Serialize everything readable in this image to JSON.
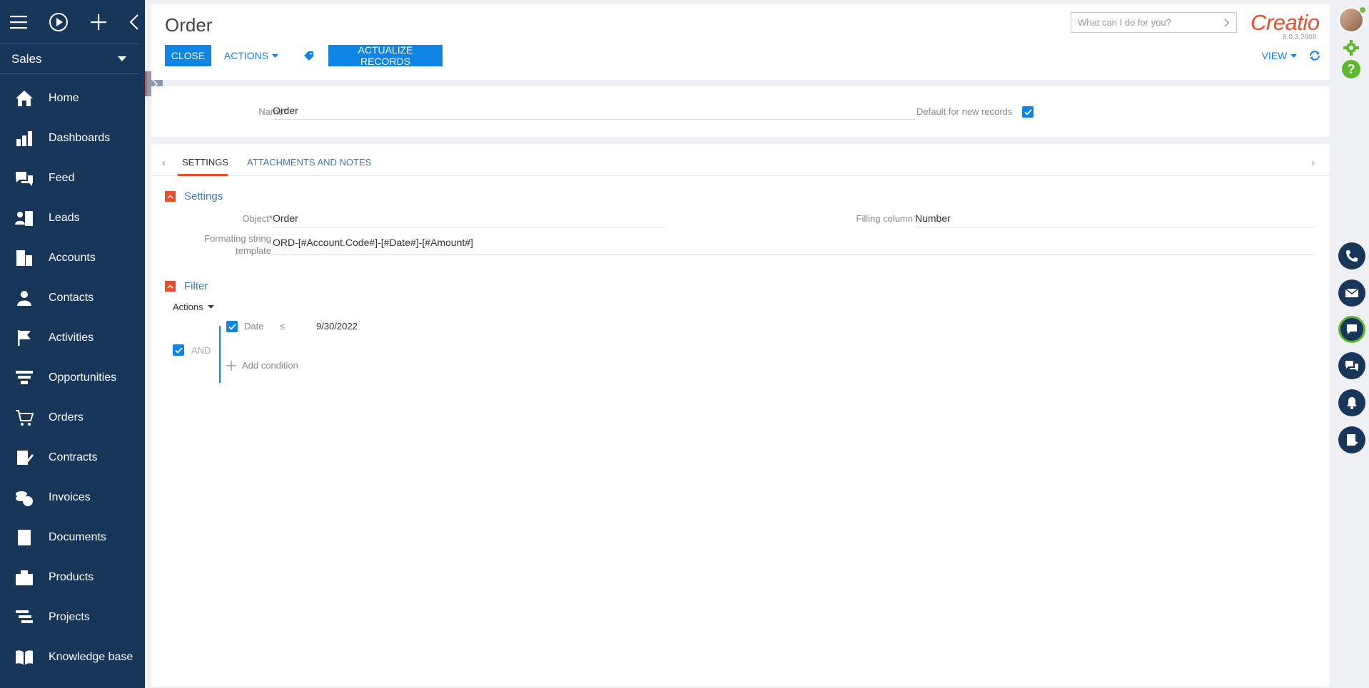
{
  "sidebar": {
    "workplace": "Sales",
    "items": [
      {
        "label": "Home",
        "icon": "home-icon"
      },
      {
        "label": "Dashboards",
        "icon": "dashboards-icon"
      },
      {
        "label": "Feed",
        "icon": "feed-icon"
      },
      {
        "label": "Leads",
        "icon": "leads-icon"
      },
      {
        "label": "Accounts",
        "icon": "accounts-icon"
      },
      {
        "label": "Contacts",
        "icon": "contacts-icon"
      },
      {
        "label": "Activities",
        "icon": "flag-icon"
      },
      {
        "label": "Opportunities",
        "icon": "funnel-icon"
      },
      {
        "label": "Orders",
        "icon": "cart-icon"
      },
      {
        "label": "Contracts",
        "icon": "contract-icon"
      },
      {
        "label": "Invoices",
        "icon": "invoice-icon"
      },
      {
        "label": "Documents",
        "icon": "document-icon"
      },
      {
        "label": "Products",
        "icon": "products-icon"
      },
      {
        "label": "Projects",
        "icon": "projects-icon"
      },
      {
        "label": "Knowledge base",
        "icon": "book-icon"
      }
    ]
  },
  "header": {
    "title": "Order",
    "close_label": "CLOSE",
    "actions_label": "ACTIONS",
    "actualize_label": "ACTUALIZE RECORDS",
    "view_label": "VIEW",
    "search_placeholder": "What can I do for you?",
    "logo": "Creatio",
    "version": "8.0.3.2908"
  },
  "name_panel": {
    "name_label": "Name",
    "name_value": "Order",
    "default_label": "Default for new records",
    "default_checked": true
  },
  "tabs": [
    {
      "label": "SETTINGS",
      "active": true
    },
    {
      "label": "ATTACHMENTS AND NOTES",
      "active": false
    }
  ],
  "settings": {
    "title": "Settings",
    "object_label": "Object",
    "object_value": "Order",
    "filling_column_label": "Filling column",
    "filling_column_value": "Number",
    "template_label_line1": "Formating string",
    "template_label_line2": "template",
    "template_value": "ORD-[#Account.Code#]-[#Date#]-[#Amount#]"
  },
  "filter": {
    "title": "Filter",
    "actions_label": "Actions",
    "group_operator": "AND",
    "condition": {
      "field": "Date",
      "operator": "≤",
      "value": "9/30/2022"
    },
    "add_condition_label": "Add condition"
  },
  "colors": {
    "sidebar_bg": "#17365a",
    "accent_blue": "#0e84e5",
    "brand_red": "#e94e2b"
  }
}
